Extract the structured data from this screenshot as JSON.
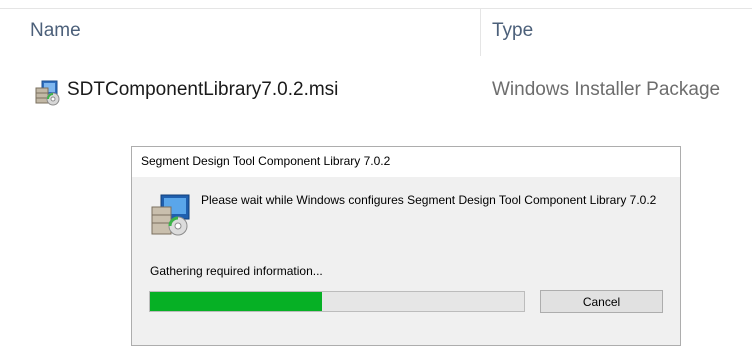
{
  "explorer": {
    "columns": {
      "name": "Name",
      "type": "Type"
    },
    "files": [
      {
        "name": "SDTComponentLibrary7.0.2.msi",
        "type": "Windows Installer Package",
        "icon": "msi-package-icon"
      }
    ]
  },
  "dialog": {
    "title": "Segment Design Tool Component Library 7.0.2",
    "message": "Please wait while Windows configures Segment Design Tool Component Library 7.0.2",
    "status": "Gathering required information...",
    "progress": 0.46,
    "progress_color": "#06b025",
    "cancel_label": "Cancel",
    "icon": "installer-setup-icon"
  }
}
